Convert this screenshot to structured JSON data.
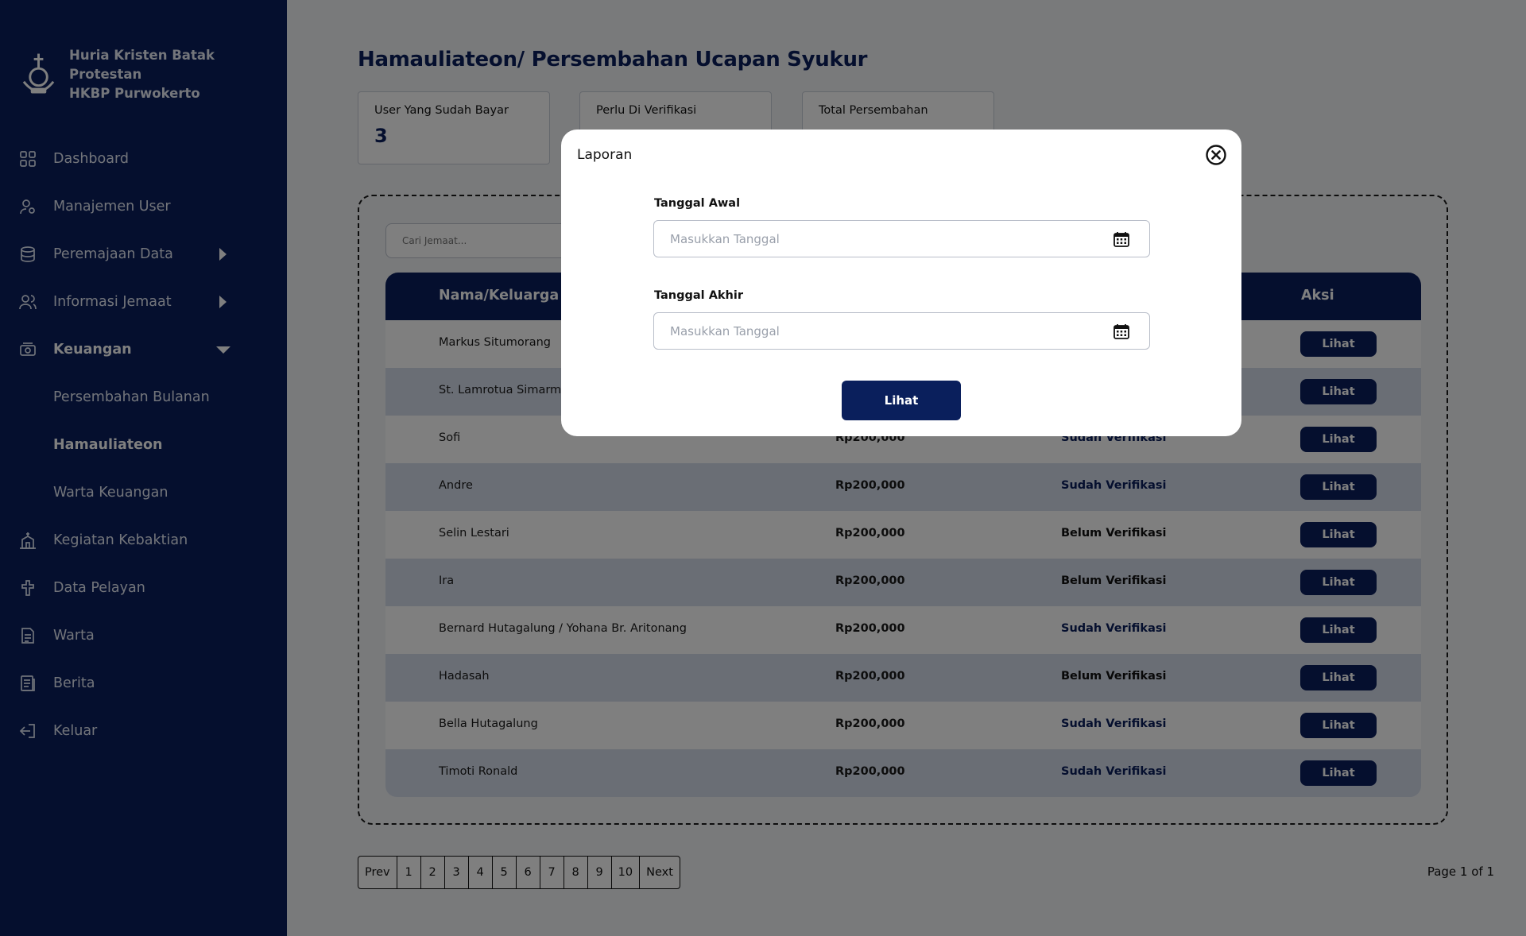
{
  "brand": {
    "line1": "Huria Kristen Batak Protestan",
    "line2": "HKBP Purwokerto"
  },
  "sidebar": {
    "items": [
      {
        "label": "Dashboard",
        "icon": "grid-icon"
      },
      {
        "label": "Manajemen User",
        "icon": "user-gear-icon"
      },
      {
        "label": "Peremajaan Data",
        "icon": "database-icon"
      },
      {
        "label": "Informasi Jemaat",
        "icon": "users-icon"
      },
      {
        "label": "Keuangan",
        "icon": "money-icon"
      },
      {
        "label": "Persembahan Bulanan"
      },
      {
        "label": "Hamauliateon"
      },
      {
        "label": "Warta Keuangan"
      },
      {
        "label": "Kegiatan Kebaktian",
        "icon": "church-icon"
      },
      {
        "label": "Data Pelayan",
        "icon": "cross-icon"
      },
      {
        "label": "Warta",
        "icon": "document-icon"
      },
      {
        "label": "Berita",
        "icon": "news-icon"
      },
      {
        "label": "Keluar",
        "icon": "logout-icon"
      }
    ]
  },
  "page": {
    "title": "Hamauliateon/ Persembahan Ucapan Syukur"
  },
  "stats": [
    {
      "label": "User Yang Sudah Bayar",
      "value": "3"
    },
    {
      "label": "Perlu Di Verifikasi",
      "value": ""
    },
    {
      "label": "Total Persembahan",
      "value": ""
    }
  ],
  "search": {
    "placeholder": "Cari Jemaat..."
  },
  "table": {
    "headers": {
      "name": "Nama/Keluarga",
      "action": "Aksi"
    },
    "button_label": "Lihat",
    "rows": [
      {
        "name": "Markus Situmorang",
        "amount": "",
        "status": "",
        "status_type": ""
      },
      {
        "name": "St. Lamrotua Simarmata",
        "amount": "",
        "status": "",
        "status_type": ""
      },
      {
        "name": "Sofi",
        "amount": "Rp200,000",
        "status": "Sudah Verifikasi",
        "status_type": "verified"
      },
      {
        "name": "Andre",
        "amount": "Rp200,000",
        "status": "Sudah Verifikasi",
        "status_type": "verified"
      },
      {
        "name": "Selin Lestari",
        "amount": "Rp200,000",
        "status": "Belum Verifikasi",
        "status_type": "unverified"
      },
      {
        "name": "Ira",
        "amount": "Rp200,000",
        "status": "Belum Verifikasi",
        "status_type": "unverified"
      },
      {
        "name": "Bernard Hutagalung / Yohana Br. Aritonang",
        "amount": "Rp200,000",
        "status": "Sudah Verifikasi",
        "status_type": "verified"
      },
      {
        "name": "Hadasah",
        "amount": "Rp200,000",
        "status": "Belum Verifikasi",
        "status_type": "unverified"
      },
      {
        "name": "Bella Hutagalung",
        "amount": "Rp200,000",
        "status": "Sudah Verifikasi",
        "status_type": "verified"
      },
      {
        "name": "Timoti Ronald",
        "amount": "Rp200,000",
        "status": "Sudah Verifikasi",
        "status_type": "verified"
      }
    ]
  },
  "pagination": {
    "prev": "Prev",
    "pages": [
      "1",
      "2",
      "3",
      "4",
      "5",
      "6",
      "7",
      "8",
      "9",
      "10"
    ],
    "next": "Next",
    "info": "Page 1 of 1"
  },
  "modal": {
    "title": "Laporan",
    "start_label": "Tanggal Awal",
    "start_placeholder": "Masukkan Tanggal",
    "end_label": "Tanggal Akhir",
    "end_placeholder": "Masukkan Tanggal",
    "submit_label": "Lihat"
  },
  "colors": {
    "primary": "#0a1f5c",
    "row_alt": "#d5dceb",
    "overlay": "rgba(0,0,0,0.5)"
  }
}
